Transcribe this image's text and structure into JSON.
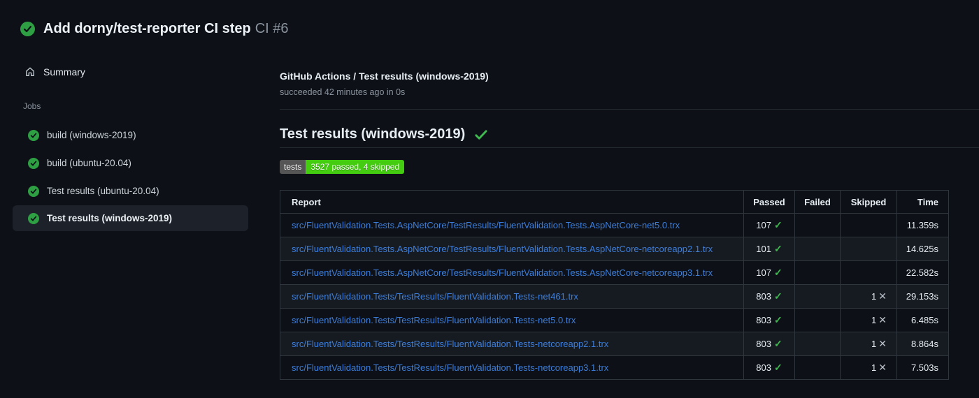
{
  "header": {
    "title": "Add dorny/test-reporter CI step",
    "run_number": "CI #6"
  },
  "sidebar": {
    "summary_label": "Summary",
    "jobs_label": "Jobs",
    "jobs": [
      {
        "label": "build (windows-2019)",
        "selected": false
      },
      {
        "label": "build (ubuntu-20.04)",
        "selected": false
      },
      {
        "label": "Test results (ubuntu-20.04)",
        "selected": false
      },
      {
        "label": "Test results (windows-2019)",
        "selected": true
      }
    ]
  },
  "main": {
    "check_title": "GitHub Actions / Test results (windows-2019)",
    "check_status": "succeeded 42 minutes ago in 0s",
    "section_title": "Test results (windows-2019)",
    "badge": {
      "label": "tests",
      "value": "3527 passed, 4 skipped"
    },
    "table": {
      "headers": [
        "Report",
        "Passed",
        "Failed",
        "Skipped",
        "Time"
      ],
      "rows": [
        {
          "report": "src/FluentValidation.Tests.AspNetCore/TestResults/FluentValidation.Tests.AspNetCore-net5.0.trx",
          "passed": "107",
          "failed": "",
          "skipped": "",
          "time": "11.359s"
        },
        {
          "report": "src/FluentValidation.Tests.AspNetCore/TestResults/FluentValidation.Tests.AspNetCore-netcoreapp2.1.trx",
          "passed": "101",
          "failed": "",
          "skipped": "",
          "time": "14.625s"
        },
        {
          "report": "src/FluentValidation.Tests.AspNetCore/TestResults/FluentValidation.Tests.AspNetCore-netcoreapp3.1.trx",
          "passed": "107",
          "failed": "",
          "skipped": "",
          "time": "22.582s"
        },
        {
          "report": "src/FluentValidation.Tests/TestResults/FluentValidation.Tests-net461.trx",
          "passed": "803",
          "failed": "",
          "skipped": "1",
          "time": "29.153s"
        },
        {
          "report": "src/FluentValidation.Tests/TestResults/FluentValidation.Tests-net5.0.trx",
          "passed": "803",
          "failed": "",
          "skipped": "1",
          "time": "6.485s"
        },
        {
          "report": "src/FluentValidation.Tests/TestResults/FluentValidation.Tests-netcoreapp2.1.trx",
          "passed": "803",
          "failed": "",
          "skipped": "1",
          "time": "8.864s"
        },
        {
          "report": "src/FluentValidation.Tests/TestResults/FluentValidation.Tests-netcoreapp3.1.trx",
          "passed": "803",
          "failed": "",
          "skipped": "1",
          "time": "7.503s"
        }
      ]
    },
    "glyphs": {
      "check": "✓",
      "cross": "✕"
    }
  },
  "colors": {
    "background": "#0d1117",
    "success_green": "#2ea043",
    "check_green": "#3fb950",
    "link_blue": "#3d7edb",
    "badge_label_bg": "#555555",
    "badge_value_bg": "#44cc11",
    "muted_text": "#8b949e",
    "table_border": "#30363d",
    "row_alt_bg": "#161b22",
    "selected_item_bg": "#1c212a"
  }
}
